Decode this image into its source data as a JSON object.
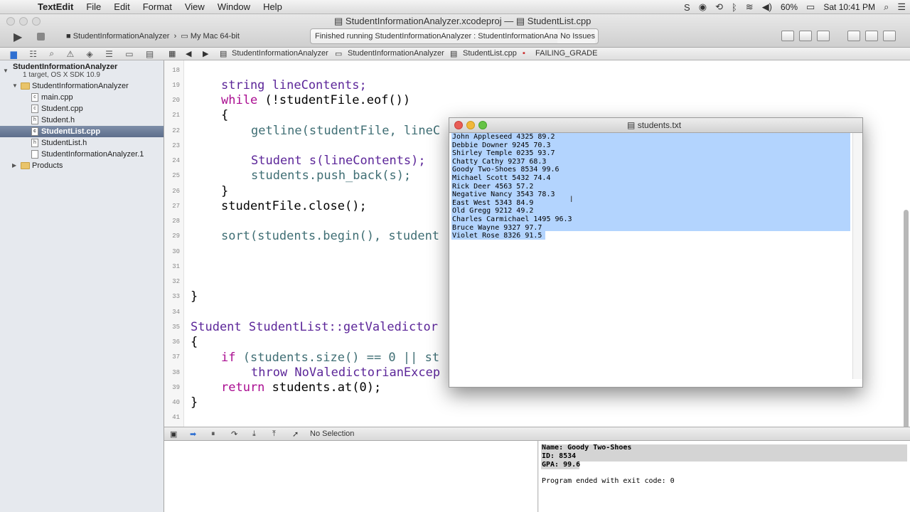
{
  "menubar": {
    "app_name": "TextEdit",
    "items": [
      "File",
      "Edit",
      "Format",
      "View",
      "Window",
      "Help"
    ],
    "battery": "60%",
    "clock": "Sat 10:41 PM"
  },
  "window": {
    "title_project": "StudentInformationAnalyzer.xcodeproj",
    "title_sep": "—",
    "title_file": "StudentList.cpp"
  },
  "toolbar": {
    "scheme": "StudentInformationAnalyzer",
    "destination": "My Mac 64-bit",
    "activity": "Finished running StudentInformationAnalyzer : StudentInformationAnalyzer",
    "issues": "No Issues"
  },
  "sidebar": {
    "project_name": "StudentInformationAnalyzer",
    "project_sub": "1 target, OS X SDK 10.9",
    "group_name": "StudentInformationAnalyzer",
    "files": [
      "main.cpp",
      "Student.cpp",
      "Student.h",
      "StudentList.cpp",
      "StudentList.h",
      "StudentInformationAnalyzer.1"
    ],
    "products": "Products"
  },
  "jumpbar": {
    "project": "StudentInformationAnalyzer",
    "group": "StudentInformationAnalyzer",
    "file": "StudentList.cpp",
    "symbol": "FAILING_GRADE"
  },
  "editor": {
    "line_numbers": [
      "18",
      "19",
      "20",
      "21",
      "22",
      "23",
      "24",
      "25",
      "26",
      "27",
      "28",
      "29",
      "30",
      "31",
      "32",
      "33",
      "34",
      "35",
      "36",
      "37",
      "38",
      "39",
      "40",
      "41"
    ],
    "code": {
      "l19": "string lineContents;",
      "l20_kw": "while",
      "l20_rest": " (!studentFile.eof())",
      "l21": "{",
      "l22": "getline(studentFile, lineC",
      "l24": "Student s(lineContents);",
      "l25": "students.push_back(s);",
      "l26": "}",
      "l27": "studentFile.close();",
      "l29": "sort(students.begin(), student",
      "l33": "}",
      "l35": "Student StudentList::getValedictor",
      "l36": "{",
      "l37_kw": "if",
      "l37_rest": " (students.size() == 0 || st",
      "l38": "throw NoValedictorianExcep",
      "l39_kw": "return",
      "l39_rest": " students.at(0);",
      "l40": "}"
    }
  },
  "debug": {
    "selection": "No Selection"
  },
  "console": {
    "lines": [
      "Name: Goody Two-Shoes",
      "ID: 8534",
      "GPA: 99.6",
      "",
      "Program ended with exit code: 0"
    ]
  },
  "textedit": {
    "title": "students.txt",
    "lines": [
      "John Appleseed 4325 89.2",
      "Debbie Downer 9245 70.3",
      "Shirley Temple 0235 93.7",
      "Chatty Cathy 9237 68.3",
      "Goody Two-Shoes 8534 99.6",
      "Michael Scott 5432 74.4",
      "Rick Deer 4563 57.2",
      "Negative Nancy 3543 78.3",
      "East West 5343 84.9",
      "Old Gregg 9212 49.2",
      "Charles Carmichael 1495 96.3",
      "Bruce Wayne 9327 97.7",
      "Violet Rose 8326 91.5"
    ]
  }
}
